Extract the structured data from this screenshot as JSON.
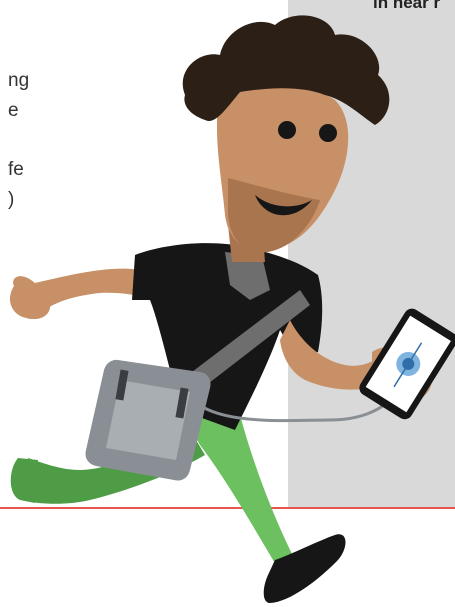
{
  "caption": {
    "top": "in near r"
  },
  "text_fragments": [
    "ng",
    "e",
    "fe",
    ")"
  ],
  "colors": {
    "skin": "#c79067",
    "hair": "#2b1f16",
    "shirt": "#161616",
    "pants": "#6cc05f",
    "pants_shadow": "#4f9c47",
    "panel": "#d9d9d9",
    "red_line": "#e5574d",
    "device": "#8a8f95"
  },
  "icons": [
    "character-illustration",
    "phone-icon",
    "shoulder-device-icon"
  ]
}
